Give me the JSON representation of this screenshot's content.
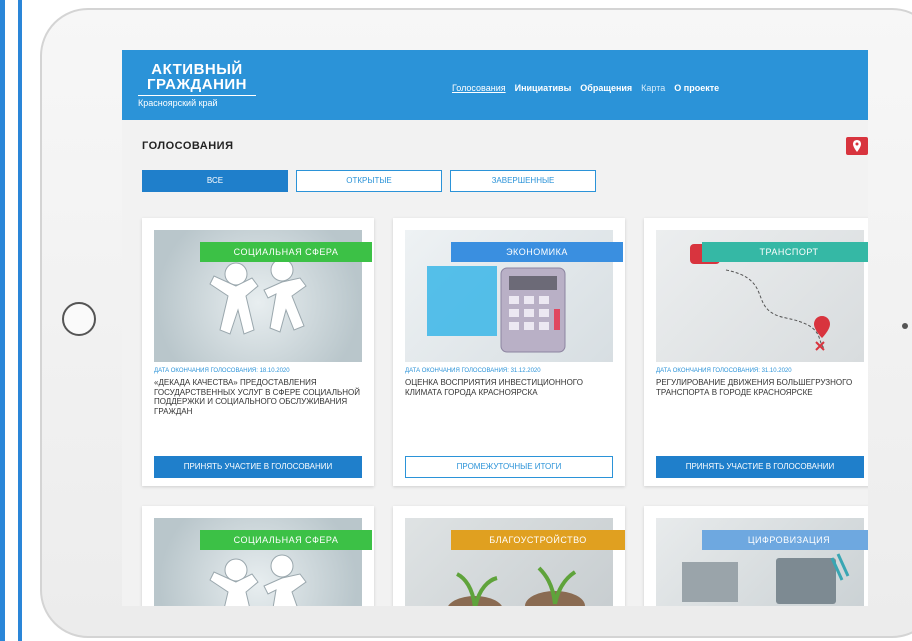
{
  "header": {
    "logo_line1": "АКТИВНЫЙ",
    "logo_line2": "ГРАЖДАНИН",
    "logo_sub": "Красноярский край",
    "nav": [
      "Голосования",
      "Инициативы",
      "Обращения",
      "Карта",
      "О проекте"
    ]
  },
  "page": {
    "title": "ГОЛОСОВАНИЯ"
  },
  "filters": [
    "ВСЕ",
    "ОТКРЫТЫЕ",
    "ЗАВЕРШЕННЫЕ"
  ],
  "cards": [
    {
      "tag": "СОЦИАЛЬНАЯ СФЕРА",
      "tag_color": "#3cc146",
      "date": "ДАТА ОКОНЧАНИЯ ГОЛОСОВАНИЯ: 18.10.2020",
      "title": "«ДЕКАДА КАЧЕСТВА» ПРЕДОСТАВЛЕНИЯ ГОСУДАРСТВЕННЫХ УСЛУГ В СФЕРЕ СОЦИАЛЬНОЙ ПОДДЕРЖКИ И СОЦИАЛЬНОГО ОБСЛУЖИВАНИЯ ГРАЖДАН",
      "button": "ПРИНЯТЬ УЧАСТИЕ В ГОЛОСОВАНИИ",
      "button_style": "solid",
      "icon": "children-figures-icon"
    },
    {
      "tag": "ЭКОНОМИКА",
      "tag_color": "#3a8fe0",
      "date": "ДАТА ОКОНЧАНИЯ ГОЛОСОВАНИЯ: 31.12.2020",
      "title": "ОЦЕНКА ВОСПРИЯТИЯ ИНВЕСТИЦИОННОГО КЛИМАТА ГОРОДА КРАСНОЯРСКА",
      "button": "ПРОМЕЖУТОЧНЫЕ ИТОГИ",
      "button_style": "outline",
      "icon": "calculator-icon"
    },
    {
      "tag": "ТРАНСПОРТ",
      "tag_color": "#35b8a5",
      "date": "ДАТА ОКОНЧАНИЯ ГОЛОСОВАНИЯ: 31.10.2020",
      "title": "РЕГУЛИРОВАНИЕ ДВИЖЕНИЯ БОЛЬШЕГРУЗНОГО ТРАНСПОРТА В ГОРОДЕ КРАСНОЯРСКЕ",
      "button": "ПРИНЯТЬ УЧАСТИЕ В ГОЛОСОВАНИИ",
      "button_style": "solid",
      "icon": "route-map-icon"
    },
    {
      "tag": "СОЦИАЛЬНАЯ СФЕРА",
      "tag_color": "#3cc146",
      "icon": "children-figures-icon"
    },
    {
      "tag": "БЛАГОУСТРОЙСТВО",
      "tag_color": "#e0a020",
      "icon": "plants-icon"
    },
    {
      "tag": "ЦИФРОВИЗАЦИЯ",
      "tag_color": "#6ea8e0",
      "icon": "devices-icon"
    }
  ]
}
